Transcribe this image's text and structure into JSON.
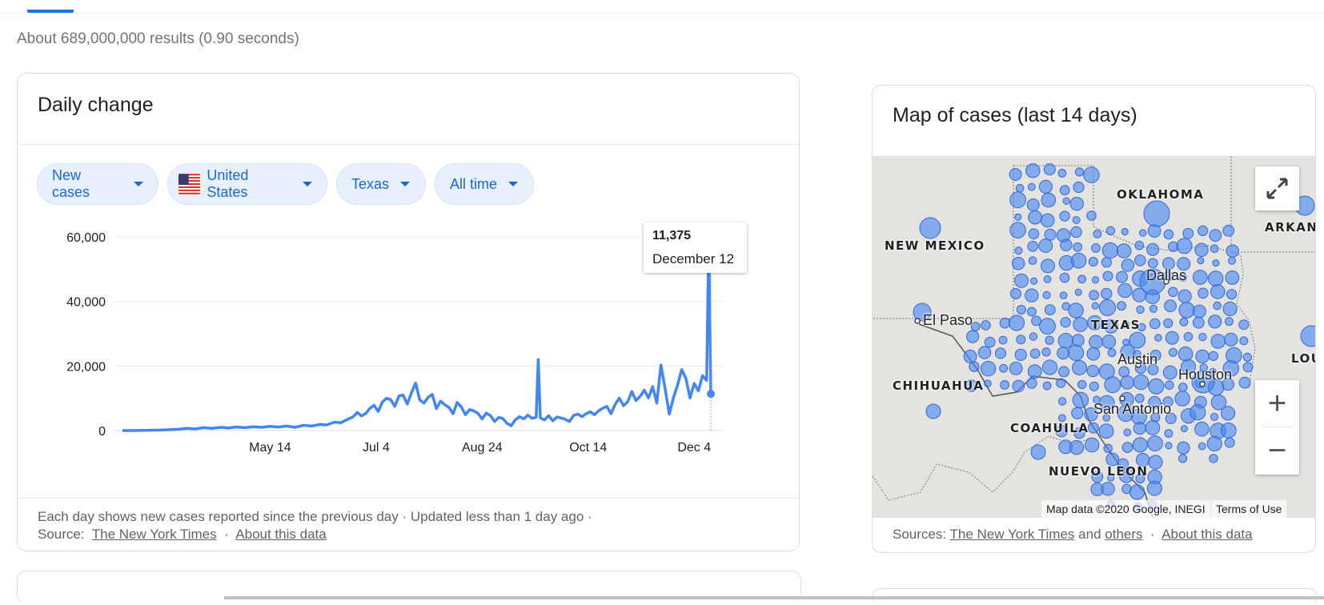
{
  "search": {
    "result_stats": "About 689,000,000 results (0.90 seconds)"
  },
  "daily": {
    "title": "Daily change",
    "chips": [
      {
        "label": "New cases"
      },
      {
        "label": "United States",
        "flag": "us-flag-icon"
      },
      {
        "label": "Texas"
      },
      {
        "label": "All time"
      }
    ],
    "tooltip": {
      "value": "11,375",
      "date": "December 12"
    },
    "footer": {
      "line1": "Each day shows new cases reported since the previous day · Updated less than 1 day ago ·",
      "source_label": "Source:",
      "source_link": "The New York Times",
      "sep": "·",
      "about_link": "About this data"
    }
  },
  "chart_data": {
    "type": "line",
    "title": "",
    "xlabel": "",
    "ylabel": "",
    "ylim": [
      0,
      60000
    ],
    "yticks": [
      0,
      20000,
      40000,
      60000
    ],
    "ytick_labels": [
      "0",
      "20,000",
      "40,000",
      "60,000"
    ],
    "xtick_labels": [
      "May 14",
      "Jul 4",
      "Aug 24",
      "Oct 14",
      "Dec 4"
    ],
    "xtick_dates": [
      "2020-05-14",
      "2020-07-04",
      "2020-08-24",
      "2020-10-14",
      "2020-12-04"
    ],
    "x_range": [
      "2020-03-04",
      "2020-12-12"
    ],
    "grid": true,
    "color": "#4285f4",
    "series": [
      {
        "points": [
          [
            "2020-03-04",
            0
          ],
          [
            "2020-03-10",
            0
          ],
          [
            "2020-03-17",
            100
          ],
          [
            "2020-03-24",
            200
          ],
          [
            "2020-03-31",
            400
          ],
          [
            "2020-04-04",
            700
          ],
          [
            "2020-04-08",
            500
          ],
          [
            "2020-04-12",
            900
          ],
          [
            "2020-04-16",
            700
          ],
          [
            "2020-04-20",
            1000
          ],
          [
            "2020-04-24",
            800
          ],
          [
            "2020-04-28",
            1100
          ],
          [
            "2020-05-02",
            900
          ],
          [
            "2020-05-06",
            1200
          ],
          [
            "2020-05-10",
            1000
          ],
          [
            "2020-05-14",
            1300
          ],
          [
            "2020-05-18",
            1100
          ],
          [
            "2020-05-22",
            1400
          ],
          [
            "2020-05-26",
            1000
          ],
          [
            "2020-05-30",
            1600
          ],
          [
            "2020-06-03",
            1400
          ],
          [
            "2020-06-07",
            1900
          ],
          [
            "2020-06-10",
            1700
          ],
          [
            "2020-06-14",
            2600
          ],
          [
            "2020-06-17",
            2400
          ],
          [
            "2020-06-20",
            3400
          ],
          [
            "2020-06-23",
            4300
          ],
          [
            "2020-06-25",
            5600
          ],
          [
            "2020-06-27",
            4500
          ],
          [
            "2020-06-29",
            5300
          ],
          [
            "2020-07-01",
            6900
          ],
          [
            "2020-07-03",
            7800
          ],
          [
            "2020-07-05",
            5900
          ],
          [
            "2020-07-07",
            8800
          ],
          [
            "2020-07-09",
            10000
          ],
          [
            "2020-07-11",
            9600
          ],
          [
            "2020-07-13",
            7500
          ],
          [
            "2020-07-15",
            10700
          ],
          [
            "2020-07-17",
            11000
          ],
          [
            "2020-07-19",
            8200
          ],
          [
            "2020-07-21",
            11700
          ],
          [
            "2020-07-23",
            14700
          ],
          [
            "2020-07-25",
            9500
          ],
          [
            "2020-07-27",
            8500
          ],
          [
            "2020-07-29",
            10300
          ],
          [
            "2020-07-31",
            11200
          ],
          [
            "2020-08-02",
            6800
          ],
          [
            "2020-08-04",
            9100
          ],
          [
            "2020-08-06",
            8000
          ],
          [
            "2020-08-08",
            7200
          ],
          [
            "2020-08-10",
            5200
          ],
          [
            "2020-08-12",
            8700
          ],
          [
            "2020-08-14",
            7300
          ],
          [
            "2020-08-16",
            4900
          ],
          [
            "2020-08-18",
            6500
          ],
          [
            "2020-08-20",
            6100
          ],
          [
            "2020-08-22",
            5300
          ],
          [
            "2020-08-24",
            3600
          ],
          [
            "2020-08-26",
            5400
          ],
          [
            "2020-08-28",
            4600
          ],
          [
            "2020-08-30",
            2800
          ],
          [
            "2020-09-01",
            4100
          ],
          [
            "2020-09-03",
            3700
          ],
          [
            "2020-09-05",
            2200
          ],
          [
            "2020-09-07",
            1500
          ],
          [
            "2020-09-09",
            3400
          ],
          [
            "2020-09-11",
            4300
          ],
          [
            "2020-09-13",
            3600
          ],
          [
            "2020-09-15",
            4800
          ],
          [
            "2020-09-17",
            3800
          ],
          [
            "2020-09-19",
            4100
          ],
          [
            "2020-09-20",
            22000
          ],
          [
            "2020-09-21",
            3900
          ],
          [
            "2020-09-23",
            3300
          ],
          [
            "2020-09-25",
            4600
          ],
          [
            "2020-09-27",
            3000
          ],
          [
            "2020-09-29",
            4200
          ],
          [
            "2020-10-01",
            3900
          ],
          [
            "2020-10-03",
            3500
          ],
          [
            "2020-10-05",
            2800
          ],
          [
            "2020-10-07",
            4700
          ],
          [
            "2020-10-09",
            5100
          ],
          [
            "2020-10-11",
            4300
          ],
          [
            "2020-10-13",
            5200
          ],
          [
            "2020-10-15",
            5800
          ],
          [
            "2020-10-17",
            4900
          ],
          [
            "2020-10-19",
            6100
          ],
          [
            "2020-10-21",
            6900
          ],
          [
            "2020-10-23",
            7500
          ],
          [
            "2020-10-25",
            5200
          ],
          [
            "2020-10-27",
            8100
          ],
          [
            "2020-10-29",
            10100
          ],
          [
            "2020-10-31",
            7700
          ],
          [
            "2020-11-02",
            8900
          ],
          [
            "2020-11-04",
            12100
          ],
          [
            "2020-11-06",
            9300
          ],
          [
            "2020-11-08",
            10600
          ],
          [
            "2020-11-10",
            12500
          ],
          [
            "2020-11-12",
            10100
          ],
          [
            "2020-11-14",
            13600
          ],
          [
            "2020-11-16",
            8500
          ],
          [
            "2020-11-18",
            20300
          ],
          [
            "2020-11-20",
            13000
          ],
          [
            "2020-11-22",
            5100
          ],
          [
            "2020-11-24",
            10200
          ],
          [
            "2020-11-26",
            14000
          ],
          [
            "2020-11-28",
            18900
          ],
          [
            "2020-11-30",
            16200
          ],
          [
            "2020-12-02",
            10100
          ],
          [
            "2020-12-04",
            14600
          ],
          [
            "2020-12-06",
            12300
          ],
          [
            "2020-12-08",
            17000
          ],
          [
            "2020-12-10",
            15500
          ],
          [
            "2020-12-11",
            60000
          ],
          [
            "2020-12-12",
            11375
          ]
        ]
      }
    ]
  },
  "map": {
    "title": "Map of cases (last 14 days)",
    "labels": {
      "oklahoma": "OKLAHOMA",
      "new_mexico": "NEW MEXICO",
      "arkansas": "ARKAN",
      "texas": "TEXAS",
      "chihuahua": "CHIHUAHUA",
      "coahuila": "COAHUILA",
      "nuevo_leon": "NUEVO LEON",
      "louisiana": "LOU"
    },
    "cities": {
      "dallas": "Dallas",
      "el_paso": "El Paso",
      "austin": "Austin",
      "houston": "Houston",
      "san_antonio": "San Antonio"
    },
    "attribution": "Map data ©2020 Google, INEGI",
    "terms": "Terms of Use",
    "zoom_in": "+",
    "zoom_out": "−",
    "sources": {
      "label": "Sources:",
      "link1": "The New York Times",
      "and": "and",
      "link2": "others",
      "sep": "·",
      "about": "About this data"
    },
    "land_color": "#e5e3df",
    "bubble_color": "#4285f4"
  }
}
